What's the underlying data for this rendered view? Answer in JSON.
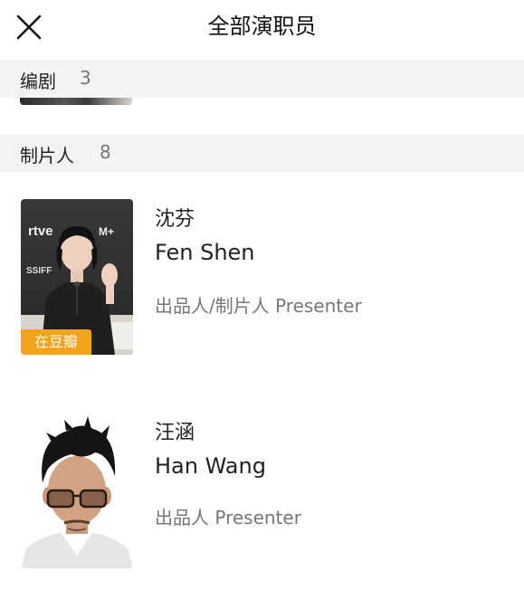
{
  "header": {
    "title": "全部演职员",
    "close_icon": "close-icon"
  },
  "sections": [
    {
      "title": "编剧",
      "count": "3"
    },
    {
      "title": "制片人",
      "count": "8"
    }
  ],
  "people": [
    {
      "name_cn": "沈芬",
      "name_en": "Fen Shen",
      "role": "出品人/制片人 Presenter",
      "badge": "在豆瓣"
    },
    {
      "name_cn": "汪涵",
      "name_en": "Han Wang",
      "role": "出品人 Presenter"
    }
  ],
  "photo_logos": {
    "rtve": "rtve",
    "ssiff": "SSIFF",
    "mplus": "M+"
  }
}
